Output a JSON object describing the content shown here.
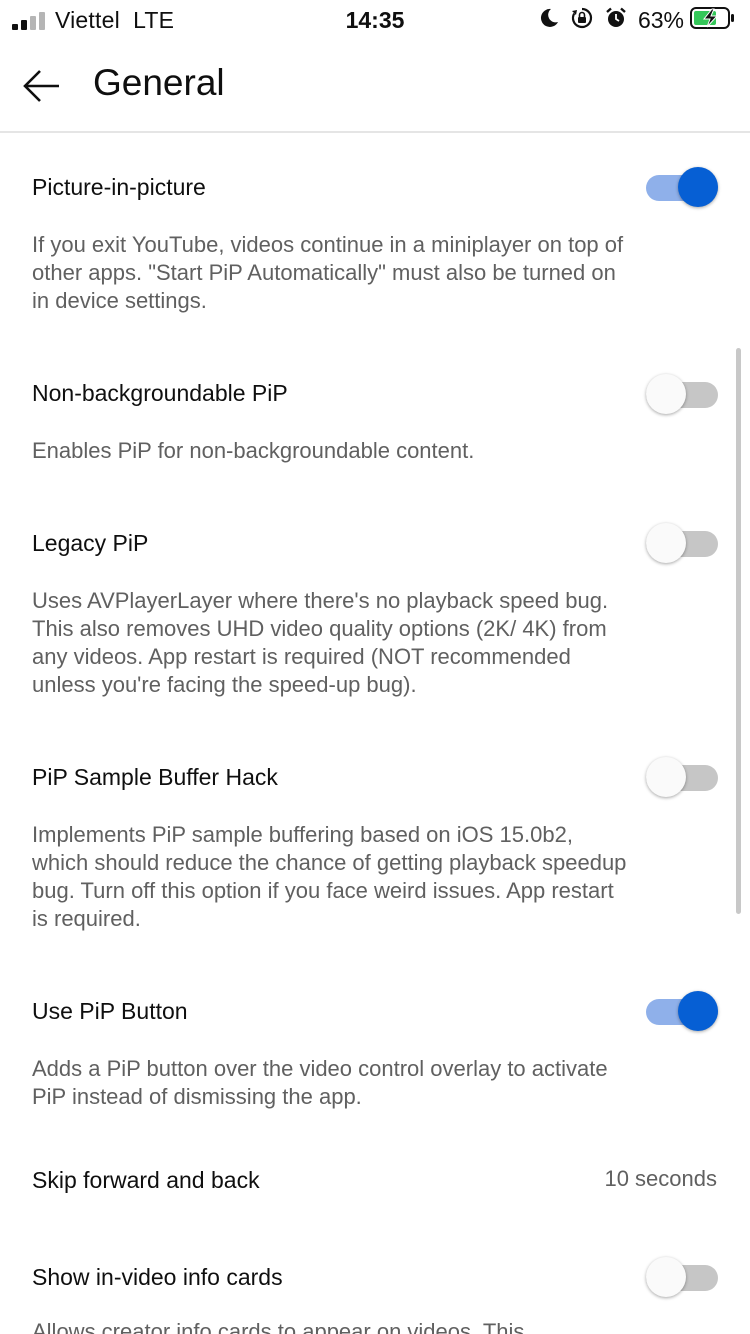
{
  "status_bar": {
    "carrier": "Viettel",
    "network": "LTE",
    "time": "14:35",
    "battery_percent": "63%",
    "icons": [
      "signal-icon",
      "moon-icon",
      "orientation-lock-icon",
      "alarm-icon",
      "battery-charging-icon"
    ]
  },
  "header": {
    "back_icon": "arrow-left-icon",
    "title": "General"
  },
  "settings": [
    {
      "title": "Picture-in-picture",
      "description": "If you exit YouTube, videos continue in a miniplayer on top of other apps. \"Start PiP Automatically\" must also be turned on in device settings.",
      "toggle": true
    },
    {
      "title": "Non-backgroundable PiP",
      "description": "Enables PiP for non-backgroundable content.",
      "toggle": false
    },
    {
      "title": "Legacy PiP",
      "description": "Uses AVPlayerLayer where there's no playback speed bug. This also removes UHD video quality options (2K/ 4K) from any videos. App restart is required (NOT recommended unless you're facing the speed-up bug).",
      "toggle": false
    },
    {
      "title": "PiP Sample Buffer Hack",
      "description": "Implements PiP sample buffering based on iOS 15.0b2, which should reduce the chance of getting playback speedup bug. Turn off this option if you face weird issues. App restart is required.",
      "toggle": false
    },
    {
      "title": "Use PiP Button",
      "description": "Adds a PiP button over the video control overlay to activate PiP instead of dismissing the app.",
      "toggle": true
    },
    {
      "title": "Skip forward and back",
      "value": "10 seconds"
    },
    {
      "title": "Show in-video info cards",
      "description": "Allows creator info cards to appear on videos. This",
      "toggle": false
    }
  ],
  "colors": {
    "accent": "#065fd4",
    "accent_track": "#8fb0ea",
    "secondary_text": "#606060",
    "primary_text": "#0f0f0f",
    "battery_green": "#34c759"
  }
}
